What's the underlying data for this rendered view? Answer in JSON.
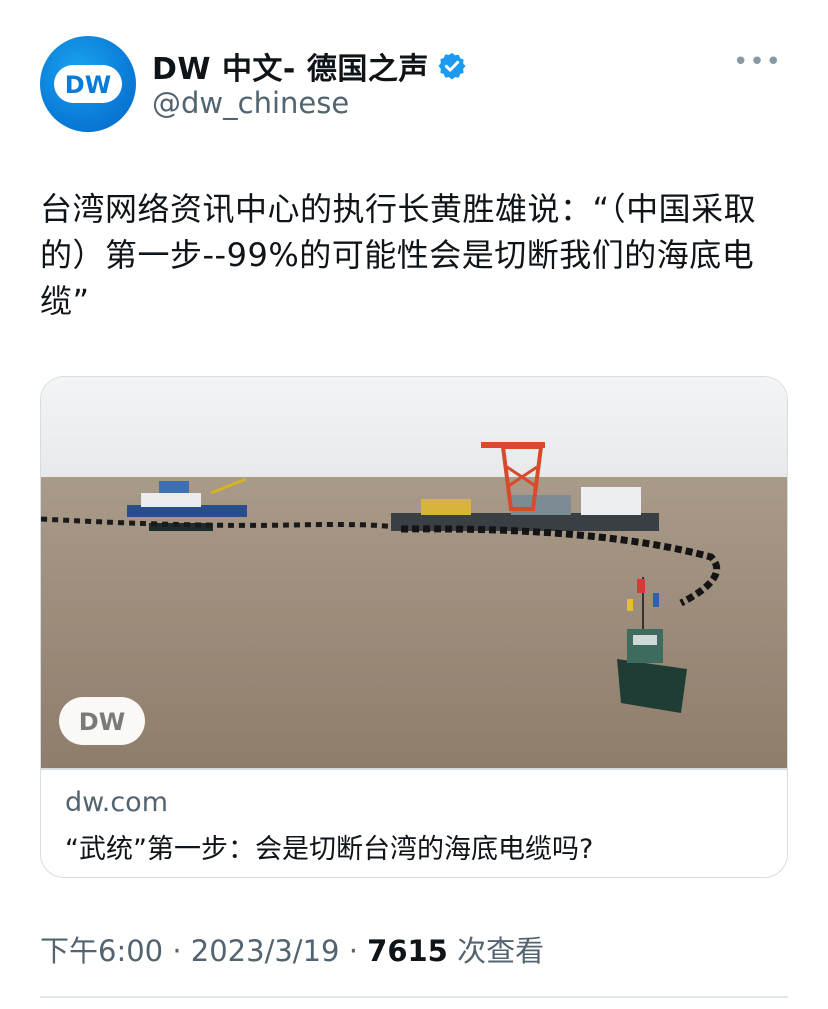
{
  "account": {
    "display_name": "DW 中文- 德国之声",
    "handle": "@dw_chinese",
    "avatar_text": "DW",
    "verified": true
  },
  "menu": {
    "more_label": "•••"
  },
  "tweet": {
    "text": "台湾网络资讯中心的执行长黄胜雄说：“（中国采取的）第一步--99%的可能性会是切断我们的海底电缆”"
  },
  "card": {
    "image_logo": "DW",
    "domain": "dw.com",
    "title": "“武统”第一步：会是切断台湾的海底电缆吗?"
  },
  "meta": {
    "time": "下午6:00",
    "separator": " · ",
    "date": "2023/3/19",
    "views_count": "7615",
    "views_label": " 次查看"
  },
  "colors": {
    "brand_blue": "#0a7cd8",
    "verified_blue": "#1d9bf0",
    "secondary_text": "#536471"
  }
}
